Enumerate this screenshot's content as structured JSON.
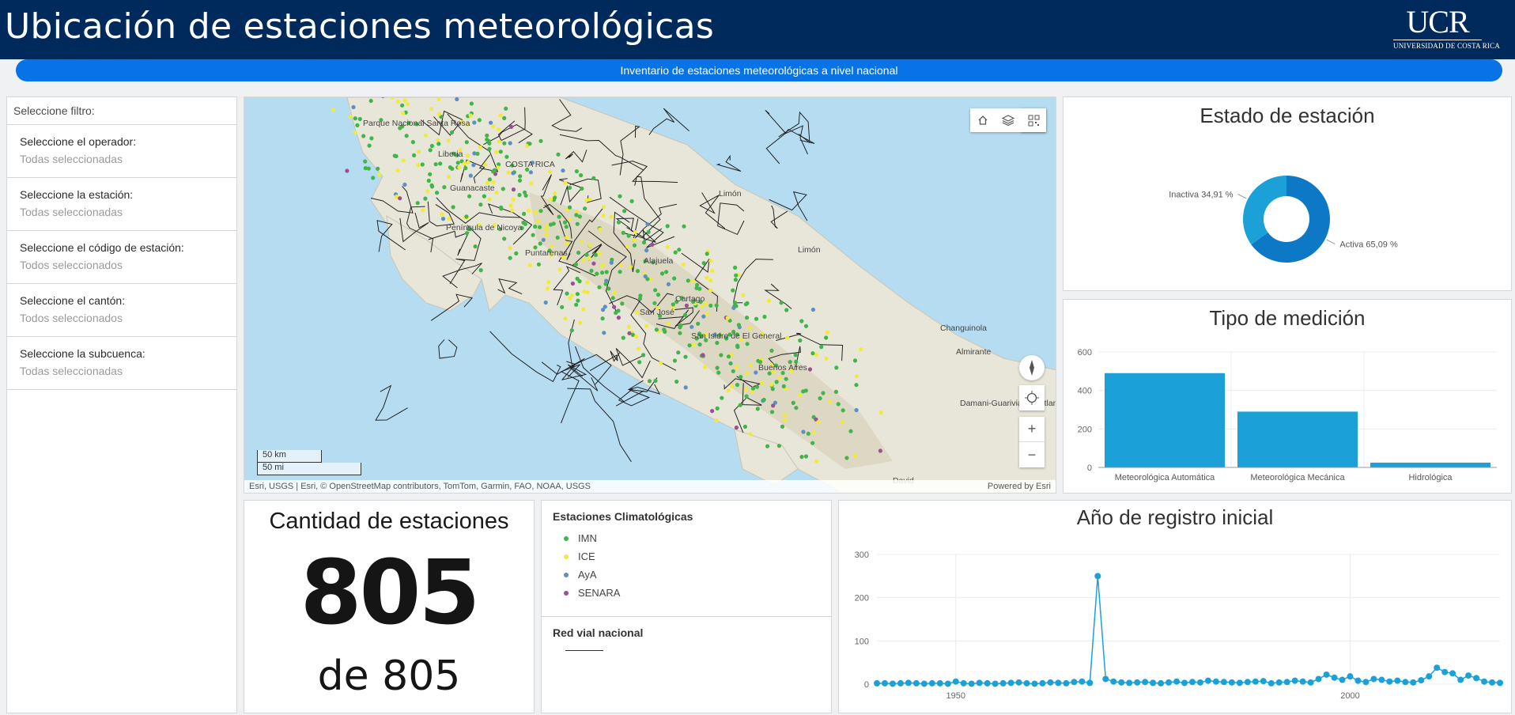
{
  "header": {
    "title": "Ubicación de estaciones meteorológicas",
    "logo_text": "UCR",
    "logo_sub": "UNIVERSIDAD DE COSTA RICA"
  },
  "subtitle": "Inventario de estaciones meteorológicas a nivel nacional",
  "filters": {
    "heading": "Seleccione filtro:",
    "items": [
      {
        "label": "Seleccione el operador:",
        "value": "Todas seleccionadas"
      },
      {
        "label": "Seleccione la estación:",
        "value": "Todas seleccionadas"
      },
      {
        "label": "Seleccione el código de estación:",
        "value": "Todos seleccionados"
      },
      {
        "label": "Seleccione el cantón:",
        "value": "Todos seleccionados"
      },
      {
        "label": "Seleccione la subcuenca:",
        "value": "Todas seleccionadas"
      }
    ]
  },
  "map": {
    "attribution": "Esri, USGS | Esri, © OpenStreetMap contributors, TomTom, Garmin, FAO, NOAA, USGS",
    "powered": "Powered by Esri",
    "scale_km": "50 km",
    "scale_mi": "50 mi",
    "labels": [
      "Parque Nacional Santa Rosa",
      "Liberia",
      "COSTA RICA",
      "Guanacaste",
      "Península de Nicoya",
      "Puntarenas",
      "Alajuela",
      "Limón",
      "Limón",
      "San José",
      "Cartago",
      "San Isidro de El General",
      "Buenos Aires",
      "Changuinola",
      "Almirante",
      "Damani-Guariviara Wetlands of International Importance",
      "David"
    ],
    "icons": [
      "search-icon",
      "home-icon",
      "layers-icon",
      "qr-icon",
      "compass-icon",
      "locate-icon",
      "plus-icon",
      "minus-icon"
    ]
  },
  "count": {
    "title": "Cantidad de estaciones",
    "value": "805",
    "of_text": "de 805"
  },
  "legend": {
    "stations_title": "Estaciones Climatológicas",
    "stations": [
      {
        "label": "IMN",
        "color": "#3fb54a"
      },
      {
        "label": "ICE",
        "color": "#f2ea3a"
      },
      {
        "label": "AyA",
        "color": "#5a8fc8"
      },
      {
        "label": "SENARA",
        "color": "#9b4f96"
      }
    ],
    "roads_title": "Red vial nacional"
  },
  "chart_data": [
    {
      "type": "pie",
      "title": "Estado de estación",
      "categories": [
        "Activa",
        "Inactiva"
      ],
      "values": [
        65.09,
        34.91
      ],
      "labels": [
        "Activa 65,09 %",
        "Inactiva 34,91 %"
      ],
      "colors": [
        "#0d79c6",
        "#1ba1d8"
      ]
    },
    {
      "type": "bar",
      "title": "Tipo de medición",
      "categories": [
        "Meteorológica Automática",
        "Meteorológica Mecánica",
        "Hidrológica"
      ],
      "values": [
        490,
        290,
        25
      ],
      "ylim": [
        0,
        600
      ],
      "yticks": [
        "0",
        "200",
        "400",
        "600"
      ],
      "color": "#1ba1d8"
    },
    {
      "type": "line",
      "title": "Año de registro inicial",
      "x": [
        1940,
        1941,
        1942,
        1943,
        1944,
        1945,
        1946,
        1947,
        1948,
        1949,
        1950,
        1951,
        1952,
        1953,
        1954,
        1955,
        1956,
        1957,
        1958,
        1959,
        1960,
        1961,
        1962,
        1963,
        1964,
        1965,
        1966,
        1967,
        1968,
        1969,
        1970,
        1971,
        1972,
        1973,
        1974,
        1975,
        1976,
        1977,
        1978,
        1979,
        1980,
        1981,
        1982,
        1983,
        1984,
        1985,
        1986,
        1987,
        1988,
        1989,
        1990,
        1991,
        1992,
        1993,
        1994,
        1995,
        1996,
        1997,
        1998,
        1999,
        2000,
        2001,
        2002,
        2003,
        2004,
        2005,
        2006,
        2007,
        2008,
        2009,
        2010,
        2011,
        2012,
        2013,
        2014,
        2015,
        2016,
        2017,
        2018,
        2019
      ],
      "y": [
        2,
        2,
        1,
        2,
        3,
        2,
        1,
        2,
        2,
        1,
        6,
        2,
        1,
        3,
        2,
        1,
        2,
        3,
        4,
        2,
        1,
        2,
        4,
        3,
        2,
        5,
        6,
        3,
        250,
        12,
        6,
        4,
        3,
        4,
        5,
        3,
        2,
        4,
        6,
        3,
        5,
        4,
        8,
        6,
        5,
        4,
        3,
        5,
        6,
        7,
        2,
        4,
        5,
        8,
        6,
        4,
        12,
        22,
        15,
        10,
        18,
        8,
        5,
        12,
        10,
        6,
        8,
        5,
        4,
        9,
        18,
        38,
        28,
        25,
        10,
        20,
        14,
        6,
        4,
        3
      ],
      "ylim": [
        0,
        300
      ],
      "yticks": [
        "0",
        "100",
        "200",
        "300"
      ],
      "xticks": [
        "1950",
        "2000"
      ],
      "color": "#1ba1d8"
    }
  ]
}
